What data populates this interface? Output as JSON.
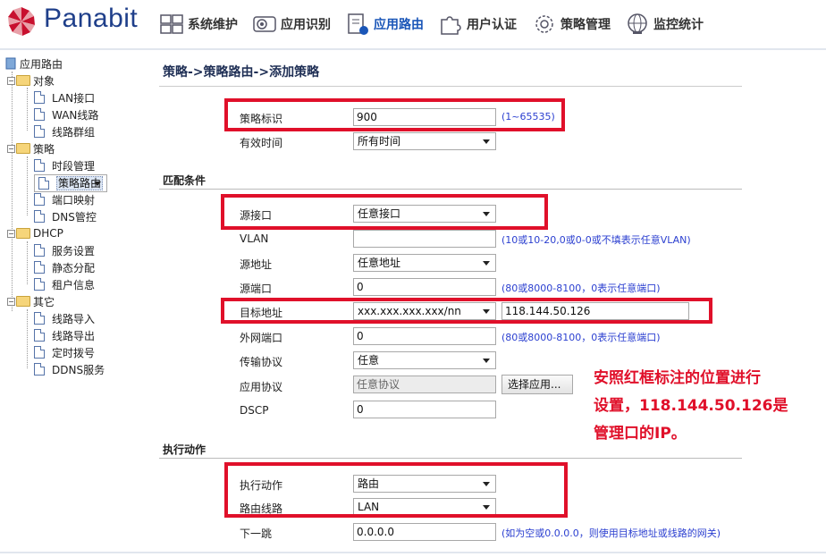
{
  "app": {
    "logo_text": "Panabit"
  },
  "nav": [
    {
      "label": "系统维护",
      "icon": "system-maintenance-icon"
    },
    {
      "label": "应用识别",
      "icon": "app-identify-icon"
    },
    {
      "label": "应用路由",
      "icon": "app-routing-icon",
      "active": true
    },
    {
      "label": "用户认证",
      "icon": "user-auth-icon"
    },
    {
      "label": "策略管理",
      "icon": "policy-manage-icon"
    },
    {
      "label": "监控统计",
      "icon": "monitor-stats-icon"
    }
  ],
  "tree": {
    "root": "应用路由",
    "groups": [
      {
        "label": "对象",
        "items": [
          "LAN接口",
          "WAN线路",
          "线路群组"
        ]
      },
      {
        "label": "策略",
        "items": [
          "时段管理",
          "策略路由",
          "端口映射",
          "DNS管控"
        ]
      },
      {
        "label": "DHCP",
        "items": [
          "服务设置",
          "静态分配",
          "租户信息"
        ]
      },
      {
        "label": "其它",
        "items": [
          "线路导入",
          "线路导出",
          "定时拨号",
          "DDNS服务"
        ]
      }
    ],
    "selected": "策略路由"
  },
  "page": {
    "title": "策略->策略路由->添加策略"
  },
  "form": {
    "policy_id": {
      "label": "策略标识",
      "value": "900",
      "hint": "(1~65535)"
    },
    "valid_time": {
      "label": "有效时间",
      "value": "所有时间"
    },
    "match_section": "匹配条件",
    "src_iface": {
      "label": "源接口",
      "value": "任意接口"
    },
    "vlan": {
      "label": "VLAN",
      "value": "",
      "hint": "(10或10-20,0或0-0或不填表示任意VLAN)"
    },
    "src_addr": {
      "label": "源地址",
      "value": "任意地址"
    },
    "src_port": {
      "label": "源端口",
      "value": "0",
      "hint": "(80或8000-8100，0表示任意端口)"
    },
    "dst_addr": {
      "label": "目标地址",
      "value": "xxx.xxx.xxx.xxx/nn",
      "ip": "118.144.50.126"
    },
    "wan_port": {
      "label": "外网端口",
      "value": "0",
      "hint": "(80或8000-8100，0表示任意端口)"
    },
    "protocol": {
      "label": "传输协议",
      "value": "任意"
    },
    "app_protocol": {
      "label": "应用协议",
      "value": "任意协议",
      "button": "选择应用..."
    },
    "dscp": {
      "label": "DSCP",
      "value": "0"
    },
    "action_section": "执行动作",
    "action": {
      "label": "执行动作",
      "value": "路由"
    },
    "route_line": {
      "label": "路由线路",
      "value": "LAN"
    },
    "next_hop": {
      "label": "下一跳",
      "value": "0.0.0.0",
      "hint": "(如为空或0.0.0.0，则使用目标地址或线路的网关)"
    }
  },
  "annotation": {
    "line1": "安照红框标注的位置进行",
    "line2": "设置，118.144.50.126是",
    "line3": "管理口的IP。",
    "color": "#e0102a"
  }
}
